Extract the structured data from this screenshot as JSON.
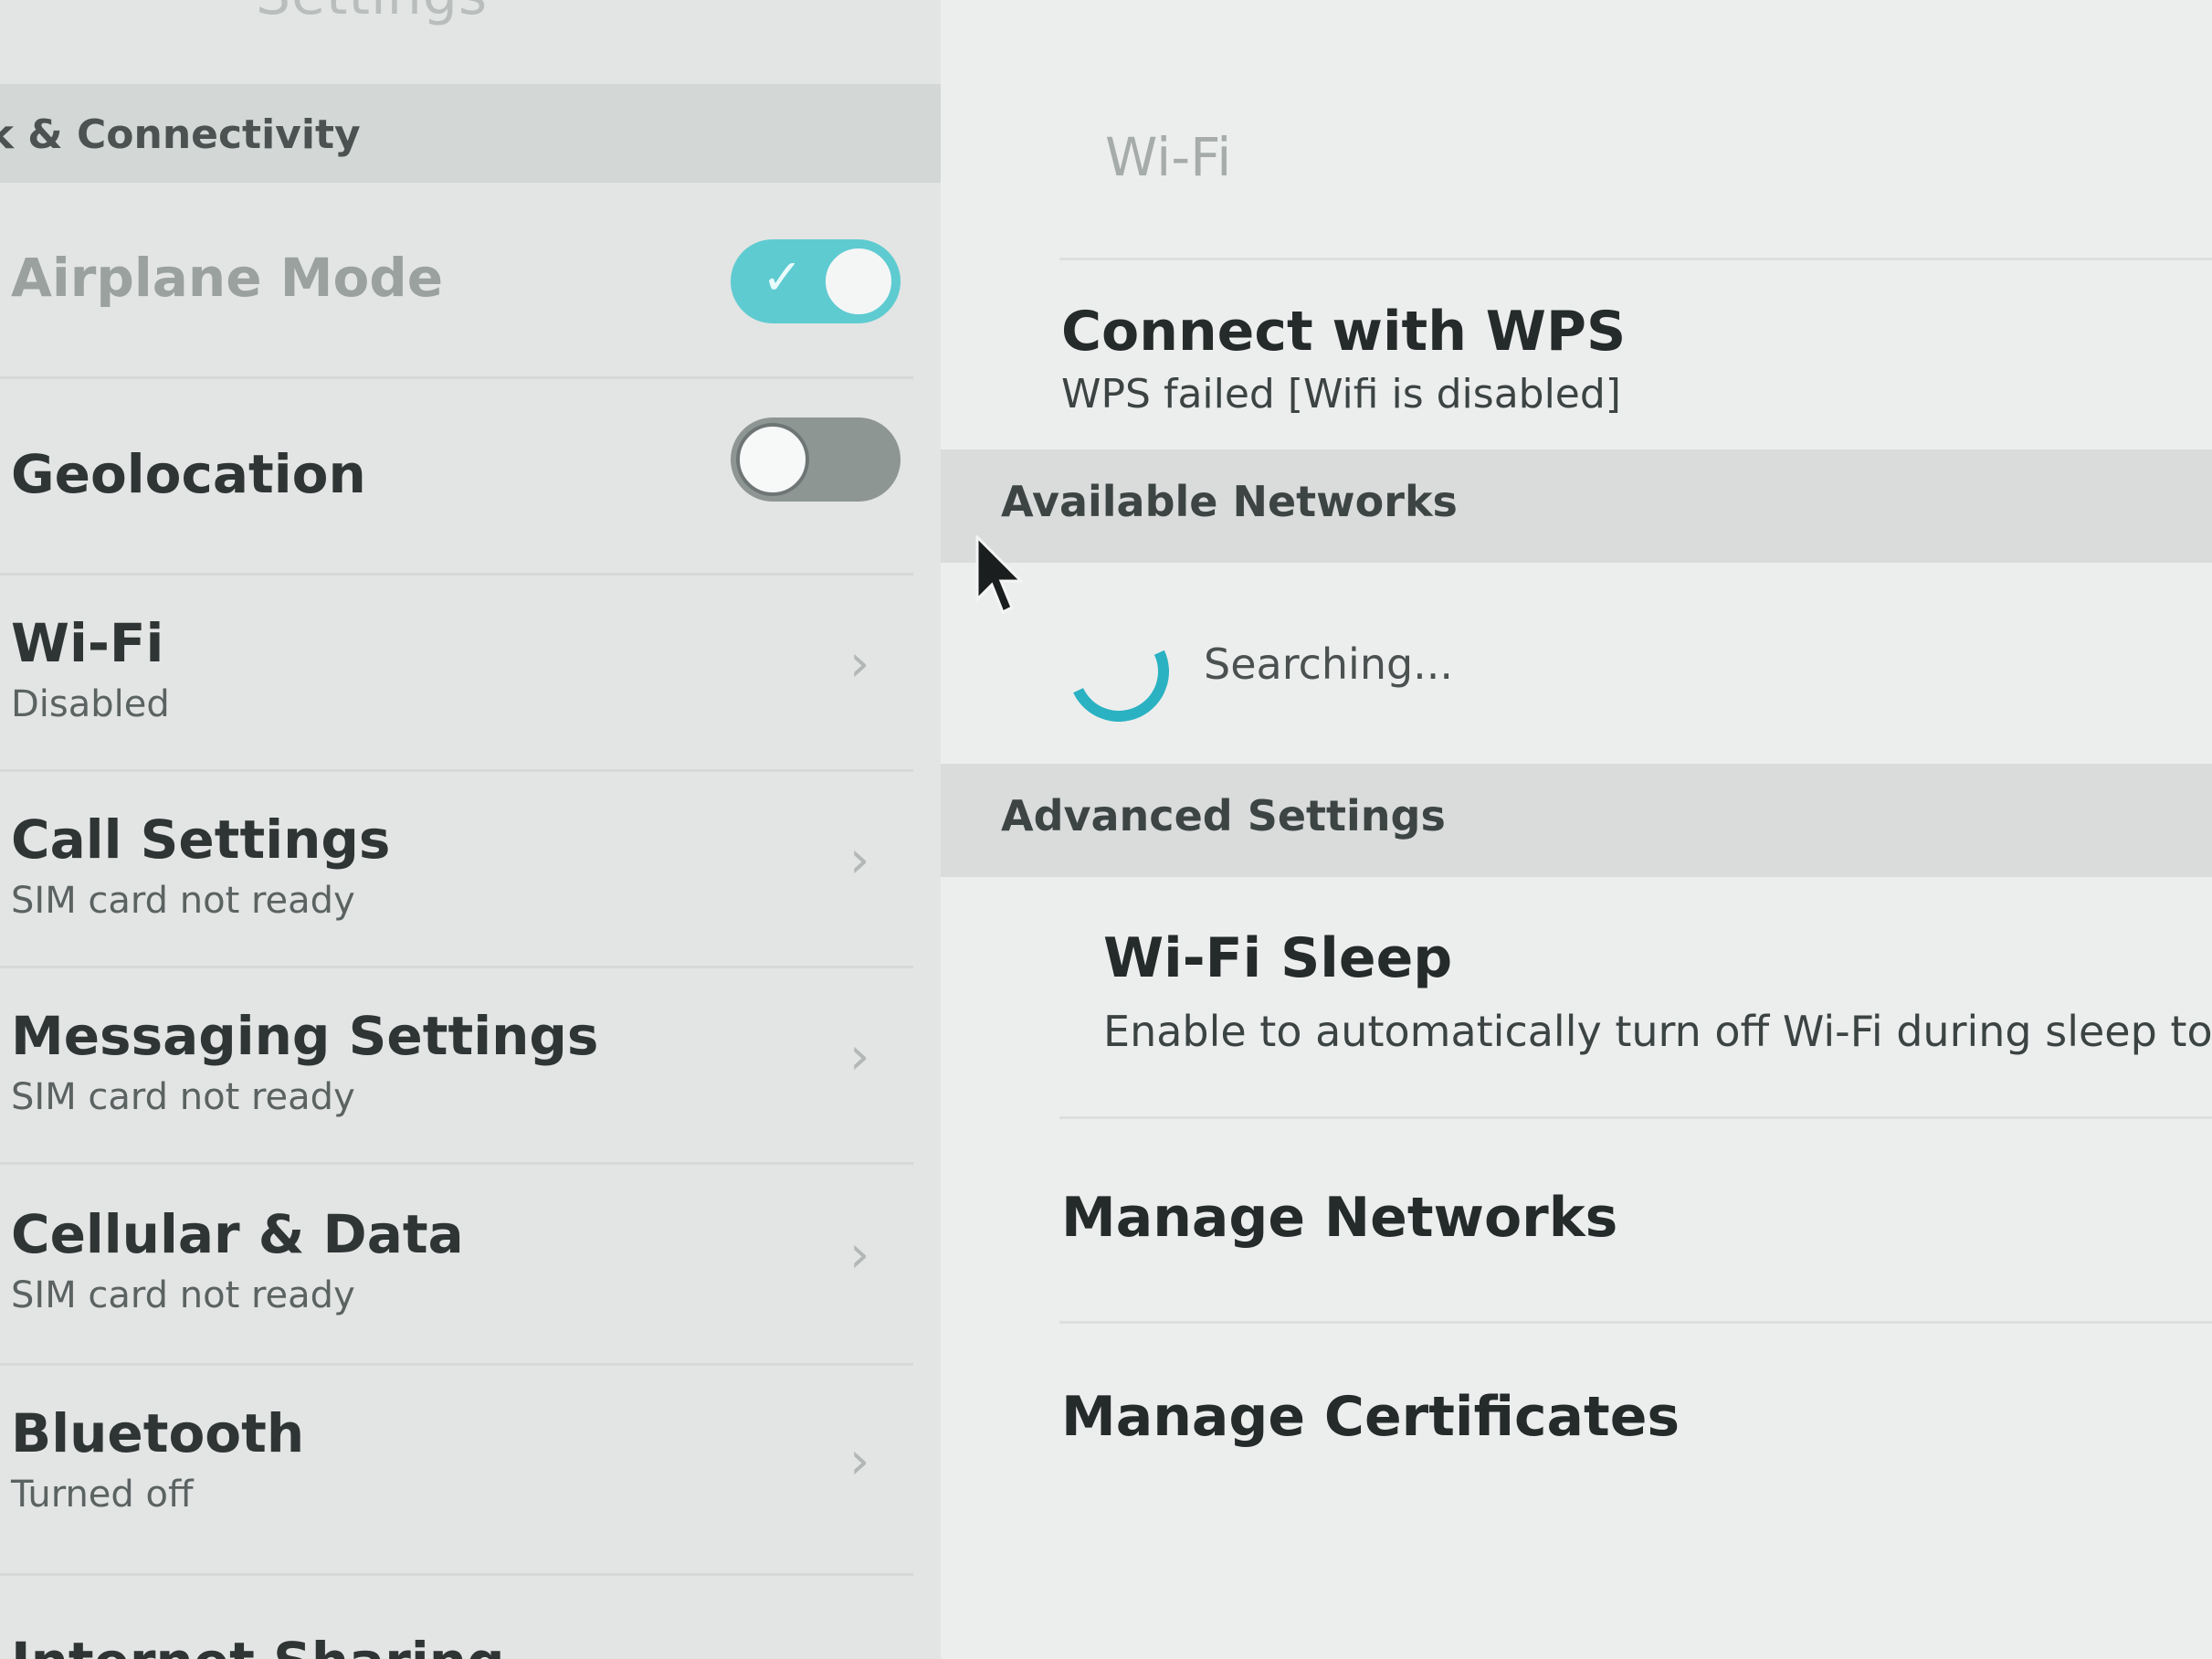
{
  "app": {
    "title": "Settings"
  },
  "left": {
    "header": "rk & Connectivity",
    "items": [
      {
        "title": "Airplane Mode",
        "toggle": "on"
      },
      {
        "title": "Geolocation",
        "toggle": "off"
      },
      {
        "title": "Wi-Fi",
        "subtitle": "Disabled"
      },
      {
        "title": "Call Settings",
        "subtitle": "SIM card not ready"
      },
      {
        "title": "Messaging Settings",
        "subtitle": "SIM card not ready"
      },
      {
        "title": "Cellular & Data",
        "subtitle": "SIM card not ready"
      },
      {
        "title": "Bluetooth",
        "subtitle": "Turned off"
      },
      {
        "title": "Internet Sharing"
      }
    ]
  },
  "right": {
    "title": "Wi-Fi",
    "wps": {
      "title": "Connect with WPS",
      "subtitle": "WPS failed [Wifi is disabled]"
    },
    "available_header": "Available Networks",
    "searching": "Searching...",
    "advanced_header": "Advanced Settings",
    "sleep": {
      "title": "Wi-Fi Sleep",
      "subtitle": "Enable to automatically turn off Wi-Fi during sleep to save"
    },
    "manage_networks": "Manage Networks",
    "manage_certificates": "Manage Certificates"
  },
  "colors": {
    "accent": "#5ecbd1",
    "spinner": "#2ab2c2"
  },
  "icons": {
    "chevron": "chevron-right-icon",
    "cursor": "mouse-pointer-icon",
    "spinner": "loading-spinner-icon"
  }
}
